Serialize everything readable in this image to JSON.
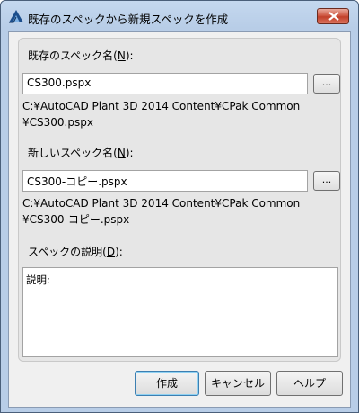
{
  "window": {
    "title": "既存のスペックから新規スペックを作成"
  },
  "icons": {
    "app": "autocad-a-icon",
    "close": "close-x-icon"
  },
  "existing": {
    "label": "既存のスペック名(",
    "accel": "N",
    "label_end": "):",
    "value": "CS300.pspx",
    "browse": "...",
    "path_line1": "C:¥AutoCAD Plant 3D 2014 Content¥CPak Common",
    "path_line2": "¥CS300.pspx"
  },
  "new": {
    "label": "新しいスペック名(",
    "accel": "N",
    "label_end": "):",
    "value": "CS300-コピー.pspx",
    "browse": "...",
    "path_line1": "C:¥AutoCAD Plant 3D 2014 Content¥CPak Common",
    "path_line2": "¥CS300-コピー.pspx"
  },
  "description": {
    "label": "スペックの説明(",
    "accel": "D",
    "label_end": "):",
    "value": "説明:"
  },
  "buttons": {
    "create": "作成",
    "cancel": "キャンセル",
    "help": "ヘルプ"
  }
}
